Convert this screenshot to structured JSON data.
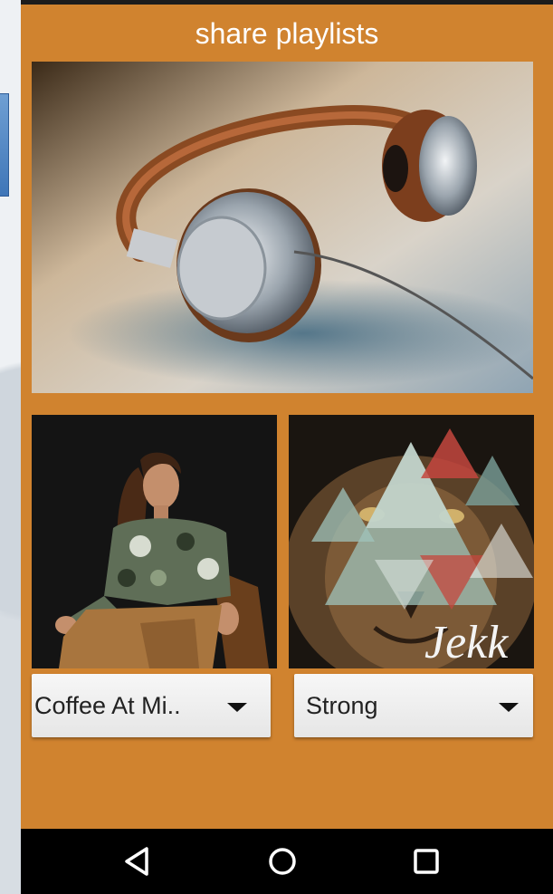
{
  "header": {
    "title": "share playlists"
  },
  "images": {
    "hero": {
      "icon": "headphones-image"
    },
    "left_art": {
      "icon": "woman-portrait-image"
    },
    "right_art": {
      "icon": "lion-triangles-image",
      "overlay_text": "Jekk"
    }
  },
  "dropdowns": {
    "left": {
      "selected": "Coffee At Mi.."
    },
    "right": {
      "selected": "Strong"
    }
  },
  "navbar": {
    "back": "back-icon",
    "home": "home-icon",
    "recent": "recent-apps-icon"
  },
  "colors": {
    "accent": "#d0832f",
    "navbar": "#000000",
    "dropdown": "#eeeeee",
    "side_tab": "#4a80c2"
  }
}
